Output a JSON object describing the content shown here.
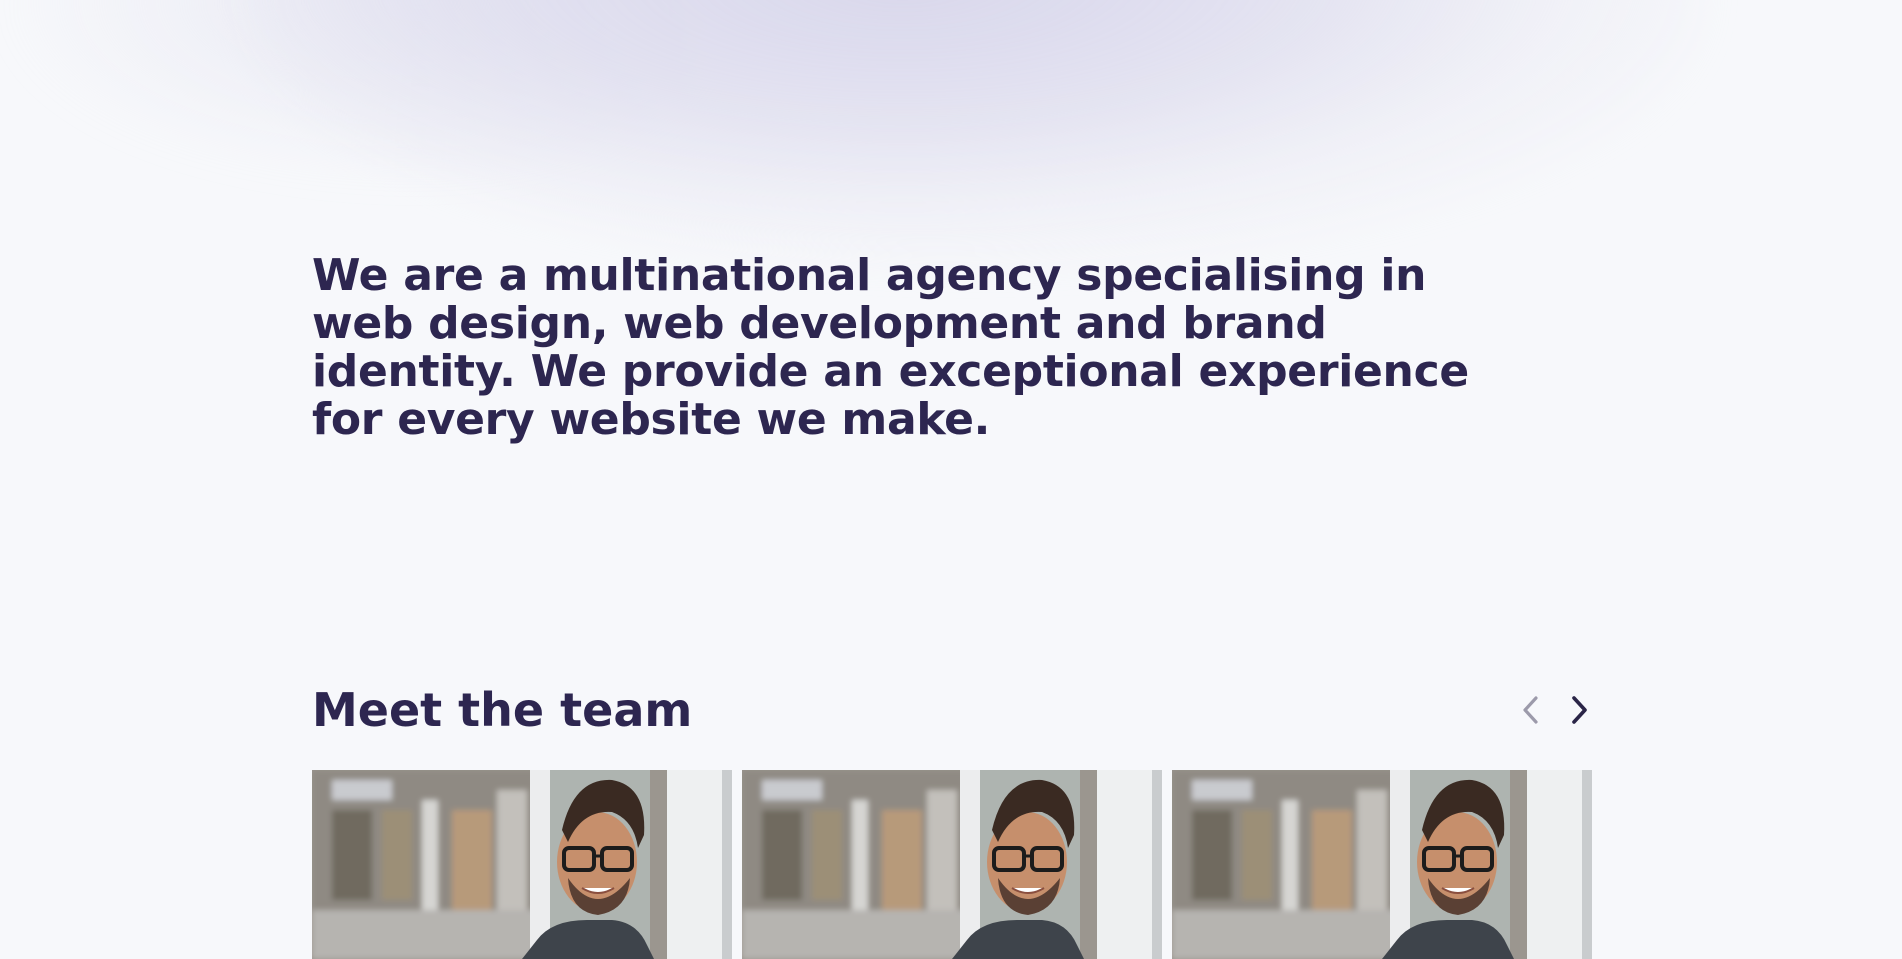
{
  "intro": {
    "text": "We are a multinational agency specialising in web design, web development and brand identity. We provide an exceptional experience for every website we make."
  },
  "team": {
    "title": "Meet the team",
    "prev_icon": "chevron-left-icon",
    "next_icon": "chevron-right-icon",
    "members": [
      {
        "photo": "team-member-photo"
      },
      {
        "photo": "team-member-photo"
      },
      {
        "photo": "team-member-photo"
      }
    ]
  },
  "colors": {
    "background": "#f7f8fb",
    "heading": "#2d2650",
    "nav_disabled": "#9c9aaa",
    "nav_active": "#2a2547"
  }
}
